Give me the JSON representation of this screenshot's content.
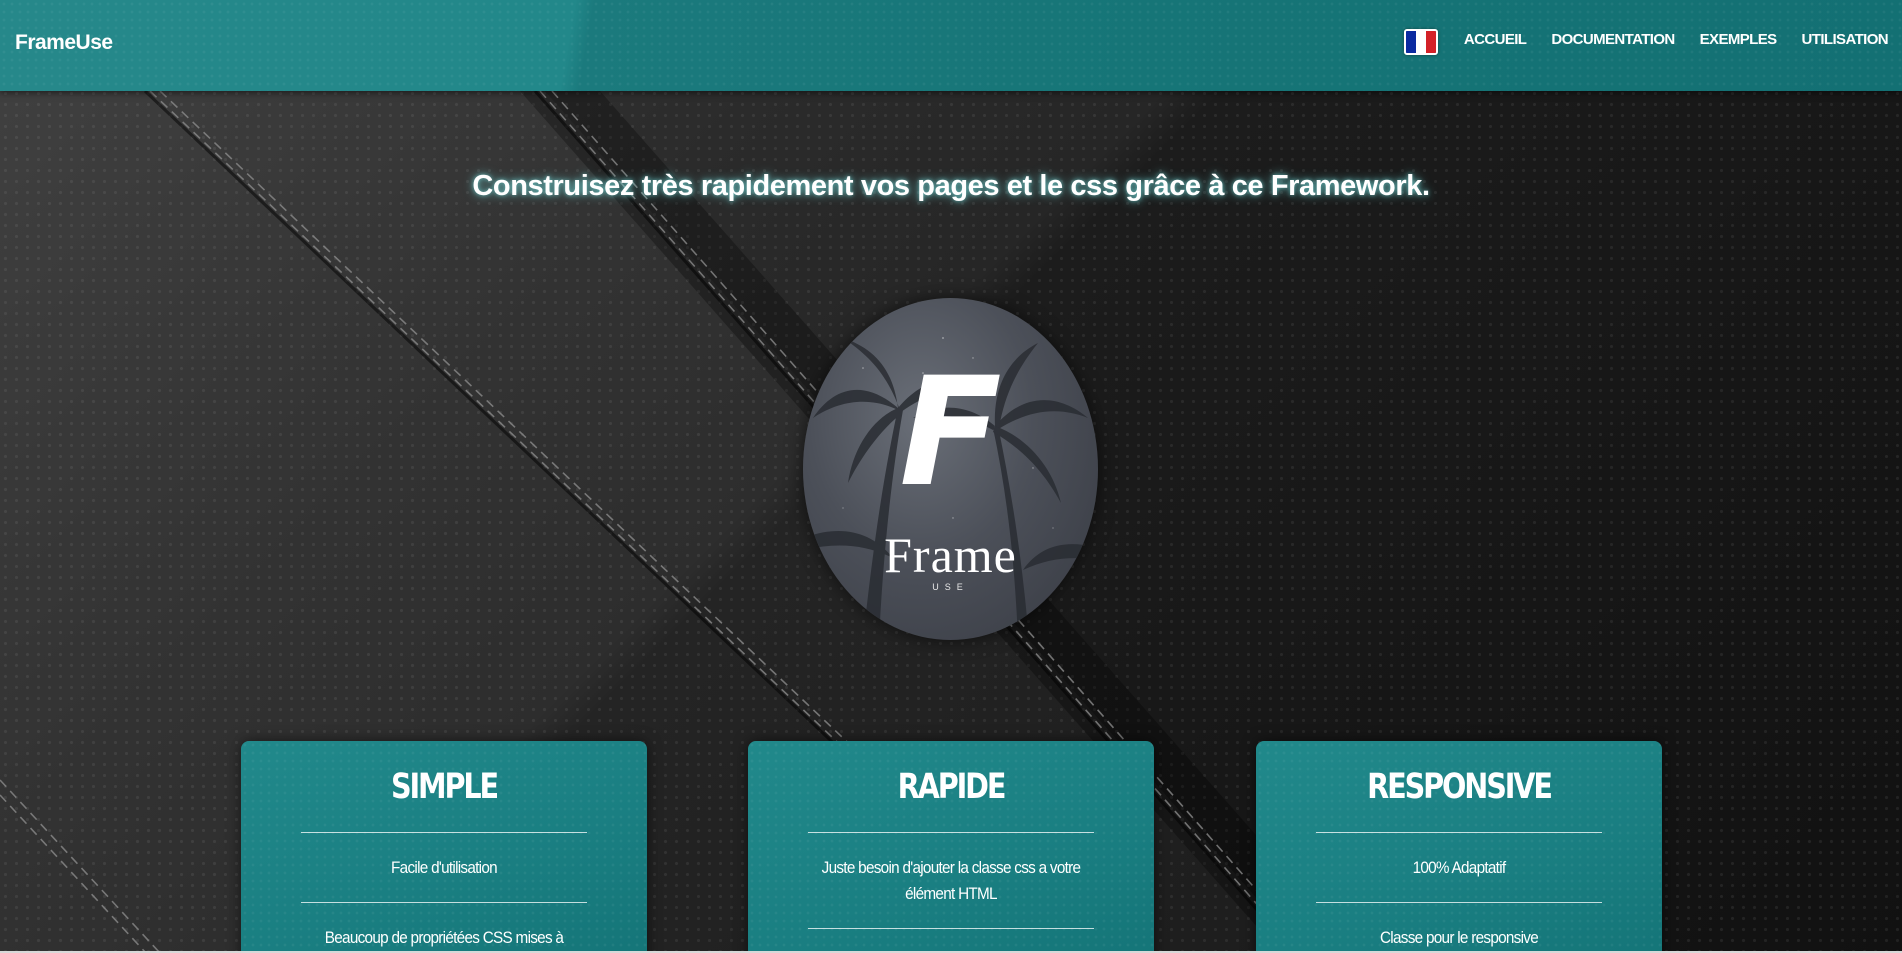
{
  "header": {
    "brand": "FrameUse",
    "language_flag": "french-flag-icon",
    "flag_colors": [
      "#0b2aa0",
      "#ffffff",
      "#d32128"
    ],
    "nav": [
      {
        "label": "ACCUEIL"
      },
      {
        "label": "DOCUMENTATION"
      },
      {
        "label": "EXEMPLES"
      },
      {
        "label": "UTILISATION"
      }
    ]
  },
  "hero": {
    "tagline": "Construisez très rapidement vos pages et le css grâce à ce Framework.",
    "logo": {
      "letter": "F",
      "word": "Frame",
      "sub": "USE"
    }
  },
  "cards": [
    {
      "title": "SIMPLE",
      "lines": [
        "Facile d'utilisation",
        "Beaucoup de propriétées CSS mises à disposition"
      ]
    },
    {
      "title": "RAPIDE",
      "lines": [
        "Juste besoin d'ajouter la classe css a votre élément HTML"
      ]
    },
    {
      "title": "RESPONSIVE",
      "lines": [
        "100% Adaptatif",
        "Classe pour le responsive"
      ]
    }
  ],
  "colors": {
    "accent": "#1a7f82",
    "tagline_glow": "#78e6e6",
    "background": "#1c1c1c"
  }
}
